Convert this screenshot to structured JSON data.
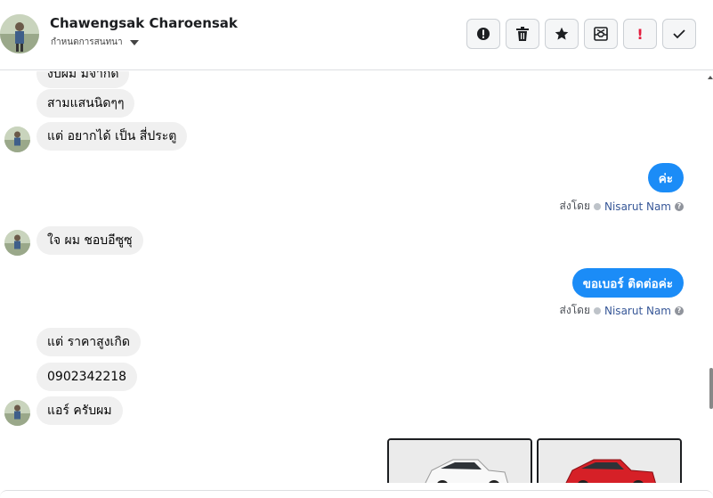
{
  "header": {
    "contact_name": "Chawengsak Charoensak",
    "label_dropdown": "กำหนดการสนทนา",
    "toolbar": {
      "icons": [
        "exclamation-circle-icon",
        "trash-icon",
        "star-icon",
        "archive-icon",
        "exclamation-icon",
        "checkmark-icon"
      ],
      "spam_mark": "!"
    }
  },
  "messages": {
    "in_cut": "งบผม มีจำกัด",
    "in_1": "สามแสนนิดๆๆ",
    "in_2": "แต่ อยากได้ เป็น สี่ประตู",
    "out_1": "ค่ะ",
    "sent_by_label_1": "ส่งโดย",
    "agent_1": "Nisarut Nam",
    "in_3": "ใจ ผม ชอบอีซูซุ",
    "out_2": "ขอเบอร์ ติดต่อค่ะ",
    "sent_by_label_2": "ส่งโดย",
    "agent_2": "Nisarut Nam",
    "in_4": "แต่ ราคาสูงเกิด",
    "in_5": "0902342218",
    "in_6": "แอร์ ครับผม"
  },
  "attachments": {
    "car_colors": [
      "#f4f4f4",
      "#d62027"
    ]
  }
}
